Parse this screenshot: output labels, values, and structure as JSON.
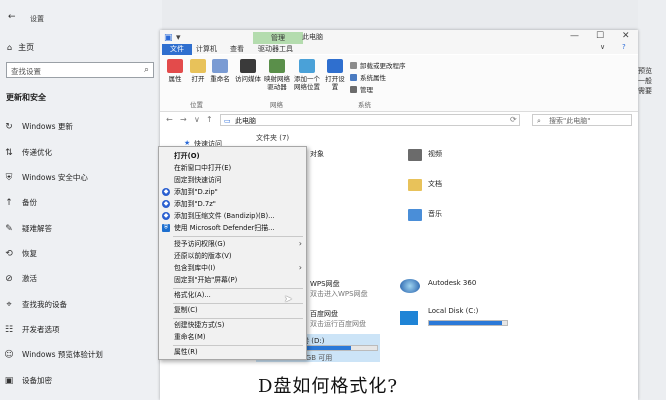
{
  "settings": {
    "title": "设置",
    "home": "主页",
    "search_placeholder": "查找设置",
    "section": "更新和安全",
    "items": [
      {
        "label": "Windows 更新",
        "icon": "refresh-icon"
      },
      {
        "label": "传递优化",
        "icon": "delivery-icon"
      },
      {
        "label": "Windows 安全中心",
        "icon": "shield-icon"
      },
      {
        "label": "备份",
        "icon": "backup-icon"
      },
      {
        "label": "疑难解答",
        "icon": "wrench-icon"
      },
      {
        "label": "恢复",
        "icon": "recovery-icon"
      },
      {
        "label": "激活",
        "icon": "check-circle-icon"
      },
      {
        "label": "查找我的设备",
        "icon": "locate-icon"
      },
      {
        "label": "开发者选项",
        "icon": "developer-icon"
      },
      {
        "label": "Windows 预览体验计划",
        "icon": "insider-icon"
      },
      {
        "label": "设备加密",
        "icon": "lock-icon"
      }
    ]
  },
  "explorer": {
    "context_tab": "管理",
    "window_title": "此电脑",
    "tabs": [
      "文件",
      "计算机",
      "查看",
      "驱动器工具"
    ],
    "ribbon": {
      "buttons": [
        "属性",
        "打开",
        "重命名",
        "访问媒体",
        "映射网络驱动器",
        "添加一个网络位置",
        "打开设置"
      ],
      "small_items": [
        "卸载或更改程序",
        "系统属性",
        "管理"
      ],
      "groups": [
        "位置",
        "网络",
        "系统"
      ]
    },
    "address": "此电脑",
    "search_placeholder": "搜索\"此电脑\"",
    "quick_access": "快速访问",
    "folders_header": "文件夹 (7)",
    "folders": [
      "视频",
      "文档",
      "音乐"
    ],
    "drives": [
      {
        "name": "WPS网盘",
        "sub": "双击进入WPS网盘"
      },
      {
        "name": "百度网盘",
        "sub": "双击运行百度网盘"
      },
      {
        "name": "Autodesk 360",
        "sub": ""
      },
      {
        "name": "Local Disk (C:)",
        "sub": "",
        "fill": 0.93
      },
      {
        "name": "新加卷 (D:)",
        "sub": "29.2 GB 可用，共 100 GB",
        "fill": 0.7
      }
    ],
    "partial_texts": {
      "folder_left": "对象",
      "left_3d": "3D",
      "d_free": "29.2 GB 可用"
    }
  },
  "context_menu": {
    "items": [
      {
        "label": "打开(O)",
        "bold": true
      },
      {
        "label": "在新窗口中打开(E)"
      },
      {
        "label": "固定到快速访问"
      },
      {
        "label": "添加到\"D.zip\"",
        "icon": true
      },
      {
        "label": "添加到\"D.7z\"",
        "icon": true
      },
      {
        "label": "添加到压缩文件 (Bandizip)(B)...",
        "icon": true
      },
      {
        "label": "使用 Microsoft Defender扫描...",
        "icon": true
      },
      {
        "label": "授予访问权限(G)",
        "arrow": true
      },
      {
        "label": "还原以前的版本(V)"
      },
      {
        "label": "包含到库中(I)",
        "arrow": true
      },
      {
        "label": "固定到\"开始\"屏幕(P)"
      },
      {
        "label": "格式化(A)..."
      },
      {
        "label": "复制(C)"
      },
      {
        "label": "创建快捷方式(S)"
      },
      {
        "label": "重命名(M)"
      },
      {
        "label": "属性(R)"
      }
    ]
  },
  "caption": "D盘如何格式化?",
  "right_text": [
    "预览",
    "一般",
    "需要"
  ],
  "colors": {
    "accent": "#2f6fcf",
    "drive_bar": "#2b79d8",
    "ctx_tab": "#b4dcae"
  }
}
